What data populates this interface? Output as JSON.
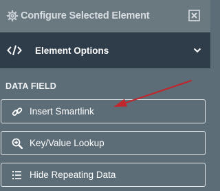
{
  "header": {
    "title": "Configure Selected Element",
    "settings_icon": "gear-icon",
    "close_icon": "close-box-icon"
  },
  "section": {
    "title": "Element Options",
    "icon": "code-icon",
    "toggle_icon": "chevron-down-icon"
  },
  "data_field": {
    "label": "DATA FIELD",
    "buttons": [
      {
        "label": "Insert Smartlink",
        "icon": "link-icon"
      },
      {
        "label": "Key/Value Lookup",
        "icon": "search-plus-icon"
      },
      {
        "label": "Hide Repeating Data",
        "icon": "list-icon"
      }
    ]
  },
  "annotation": {
    "type": "arrow",
    "color": "#c0272d",
    "points_to": "Insert Smartlink"
  },
  "colors": {
    "panel_bg": "#5d6d77",
    "topbar_bg": "#6a7880",
    "section_header_bg": "#2f3d4a",
    "button_border": "#e4e8eb"
  }
}
